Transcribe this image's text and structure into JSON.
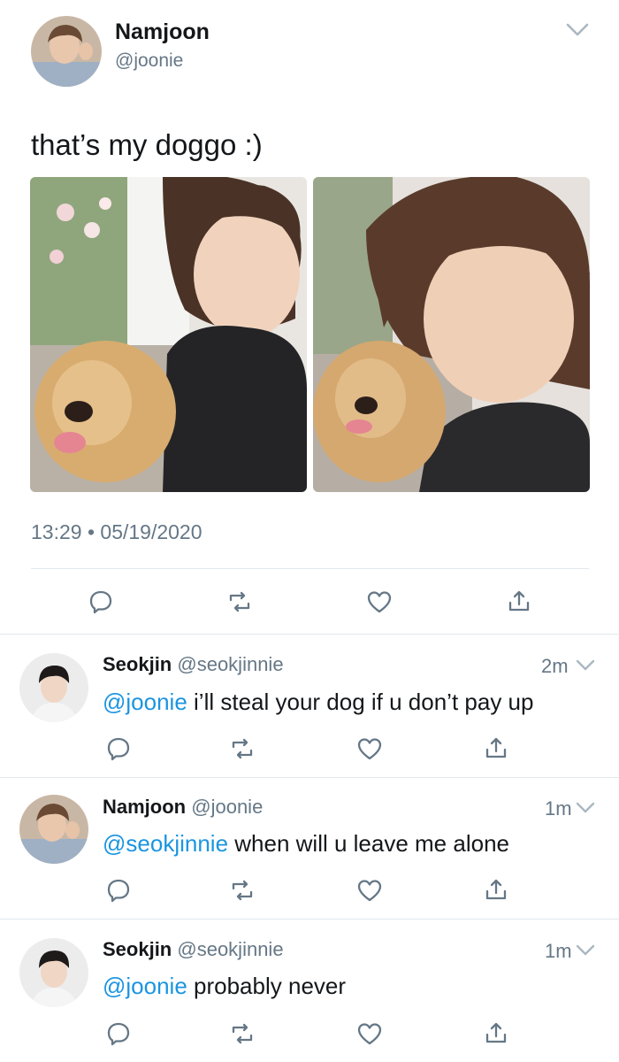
{
  "main_tweet": {
    "author_name": "Namjoon",
    "author_handle": "@joonie",
    "text": "that’s my doggo :)",
    "time": "13:29",
    "date": "05/19/2020",
    "photos": [
      {
        "icon": "selfie-with-dog-photo"
      },
      {
        "icon": "selfie-with-dog-closeup-photo"
      }
    ]
  },
  "replies": [
    {
      "name": "Seokjin",
      "handle": "@seokjinnie",
      "age": "2m",
      "mention": "@joonie",
      "text": " i’ll steal your dog if u don’t pay up"
    },
    {
      "name": "Namjoon",
      "handle": "@joonie",
      "age": "1m",
      "mention": "@seokjinnie",
      "text": " when will u leave me alone"
    },
    {
      "name": "Seokjin",
      "handle": "@seokjinnie",
      "age": "1m",
      "mention": "@joonie",
      "text": " probably never"
    }
  ],
  "colors": {
    "link": "#1b95e0",
    "muted": "#657786",
    "divider": "#e1e8ed"
  },
  "icons": {
    "reply": "speech-bubble-icon",
    "retweet": "retweet-arrows-icon",
    "like": "heart-icon",
    "share": "share-upload-icon",
    "menu": "chevron-down-icon"
  }
}
